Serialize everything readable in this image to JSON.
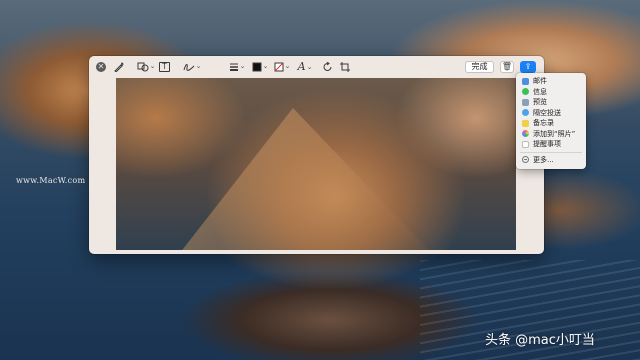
{
  "toolbar": {
    "icons": [
      "close-icon",
      "markup-pen-icon",
      "shapes-icon",
      "text-icon",
      "sign-icon",
      "line-style-icon",
      "border-color-icon",
      "fill-color-icon",
      "text-style-icon",
      "rotate-icon",
      "crop-icon"
    ],
    "text_tool_label": "T",
    "text_style_label": "A",
    "done_label": "完成",
    "trash_glyph": "🗑",
    "share_glyph": "⇪"
  },
  "share_menu": {
    "items": [
      {
        "label": "邮件",
        "icon": "mail-icon",
        "color": "#4a8fe0"
      },
      {
        "label": "信息",
        "icon": "messages-icon",
        "color": "#3fbf5a"
      },
      {
        "label": "预览",
        "icon": "preview-icon",
        "color": "#8aa0b8"
      },
      {
        "label": "隔空投送",
        "icon": "airdrop-icon",
        "color": "#4aa5e8"
      },
      {
        "label": "备忘录",
        "icon": "notes-icon",
        "color": "#f2cf48"
      },
      {
        "label": "添加到“照片”",
        "icon": "photos-icon",
        "color": "#e86a6a"
      },
      {
        "label": "提醒事项",
        "icon": "reminders-icon",
        "color": "#ffffff"
      }
    ],
    "more_label": "更多..."
  },
  "watermarks": {
    "left": "www.MacW.com",
    "brand": "头条 @mac小叮当"
  }
}
